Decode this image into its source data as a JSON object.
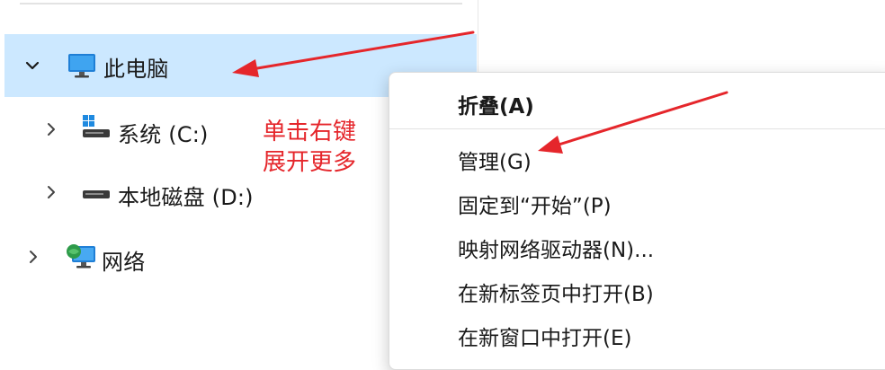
{
  "tree": {
    "this_pc": {
      "label": "此电脑",
      "icon": "monitor-icon",
      "expanded": true
    },
    "system_drive": {
      "label": "系统 (C:)",
      "icon": "windows-drive-icon"
    },
    "local_disk": {
      "label": "本地磁盘 (D:)",
      "icon": "hard-drive-icon"
    },
    "network": {
      "label": "网络",
      "icon": "network-icon"
    }
  },
  "annotation": {
    "line1": "单击右键",
    "line2": "展开更多",
    "color": "#e5262b"
  },
  "context_menu": {
    "items": [
      {
        "label": "折叠(A)",
        "bold": true
      },
      {
        "label": "管理(G)"
      },
      {
        "label": "固定到“开始”(P)"
      },
      {
        "label": "映射网络驱动器(N)..."
      },
      {
        "label": "在新标签页中打开(B)"
      },
      {
        "label": "在新窗口中打开(E)"
      }
    ]
  },
  "colors": {
    "selection": "#cce8ff",
    "arrow": "#e5262b"
  }
}
